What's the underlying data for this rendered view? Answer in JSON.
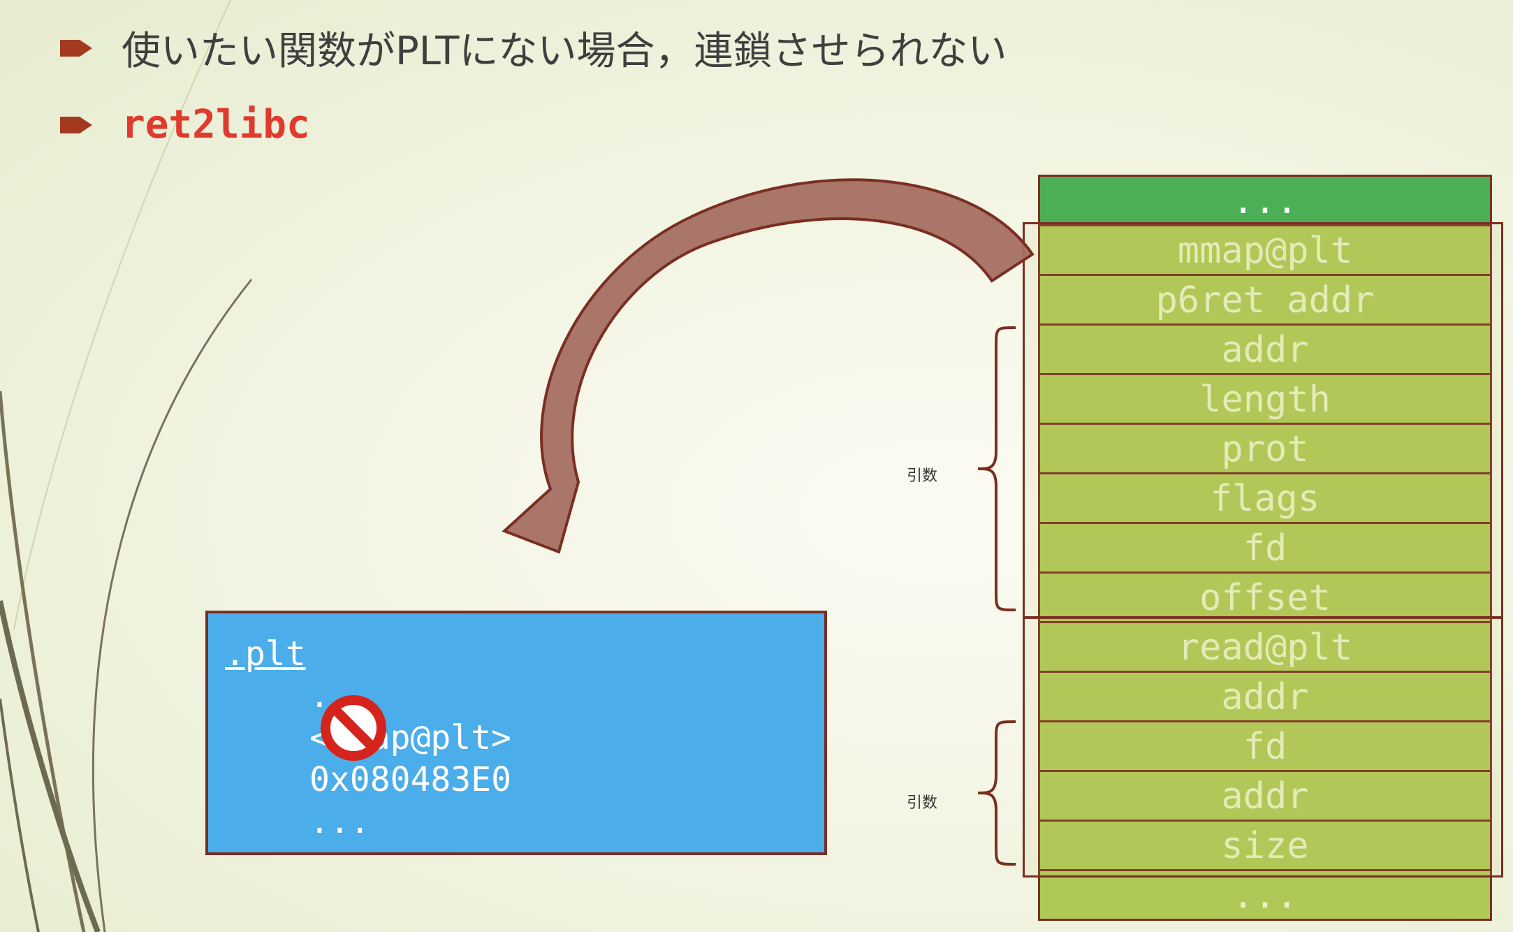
{
  "bullets": [
    {
      "text": "使いたい関数がPLTにない場合，連鎖させられない"
    },
    {
      "text": "ret2libc"
    }
  ],
  "stack": {
    "cells": [
      "...",
      "mmap@plt",
      "p6ret addr",
      "addr",
      "length",
      "prot",
      "flags",
      "fd",
      "offset",
      "read@plt",
      "addr",
      "fd",
      "addr",
      "size",
      "..."
    ]
  },
  "brackets": [
    {
      "label": "引数"
    },
    {
      "label": "引数"
    }
  ],
  "plt_box": {
    "title": ".plt",
    "lines": [
      ".",
      "<mmap@plt>",
      "0x080483E0",
      "..."
    ]
  },
  "icons": {
    "bullet": "arrow-icon",
    "blocked": "no-entry-icon"
  },
  "colors": {
    "accent": "#e03a2f",
    "stack_green": "#afc956",
    "stack_top": "#4cae55",
    "plt_blue": "#4badea",
    "border": "#7a2e22",
    "arrow_fill": "#a46f62"
  }
}
